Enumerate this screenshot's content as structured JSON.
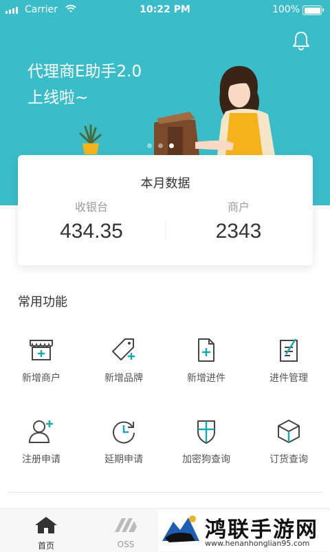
{
  "status_bar": {
    "carrier": "Carrier",
    "time": "10:22 PM",
    "battery": "100%"
  },
  "banner": {
    "line1": "代理商E助手2.0",
    "line2": "上线啦~",
    "slide_count": 3,
    "active_slide": 3
  },
  "monthly": {
    "title": "本月数据",
    "left_label": "收银台",
    "left_value": "434.35",
    "right_label": "商户",
    "right_value": "2343"
  },
  "section_title": "常用功能",
  "functions": [
    {
      "label": "新增商户",
      "icon": "storefront-add-icon"
    },
    {
      "label": "新增品牌",
      "icon": "tag-add-icon"
    },
    {
      "label": "新增进件",
      "icon": "document-add-icon"
    },
    {
      "label": "进件管理",
      "icon": "document-edit-icon"
    },
    {
      "label": "注册申请",
      "icon": "user-add-icon"
    },
    {
      "label": "延期申请",
      "icon": "clock-refresh-icon"
    },
    {
      "label": "加密狗查询",
      "icon": "shield-icon"
    },
    {
      "label": "订货查询",
      "icon": "box-icon"
    }
  ],
  "tabs": [
    {
      "label": "首页",
      "icon": "home-icon"
    },
    {
      "label": "OSS",
      "icon": "oss-icon"
    }
  ],
  "promo": {
    "title": "鸿联手游网",
    "url": "www.henanhonglian95.com"
  },
  "colors": {
    "primary": "#3bbdc9",
    "accent": "#19a9b5",
    "apron": "#f5b31b"
  }
}
